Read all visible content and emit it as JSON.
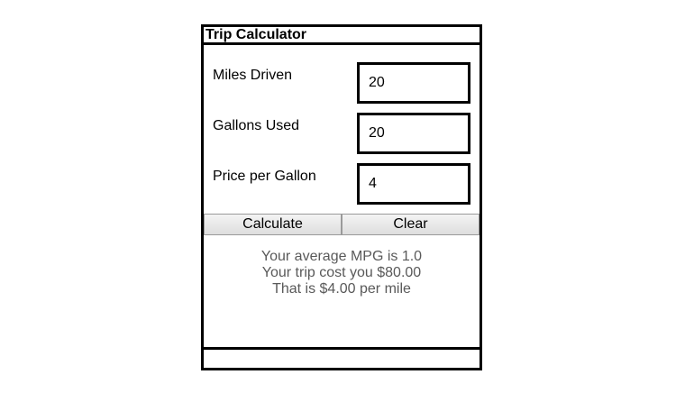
{
  "app": {
    "title": "Trip Calculator"
  },
  "form": {
    "miles": {
      "label": "Miles Driven",
      "value": "20"
    },
    "gallons": {
      "label": "Gallons Used",
      "value": "20"
    },
    "price": {
      "label": "Price per Gallon",
      "value": "4"
    }
  },
  "buttons": {
    "calculate_label": "Calculate",
    "clear_label": "Clear"
  },
  "results": {
    "mpg_line": "Your average MPG is 1.0",
    "cost_line": "Your trip cost you $80.00",
    "per_mile_line": "That is $4.00 per mile"
  }
}
